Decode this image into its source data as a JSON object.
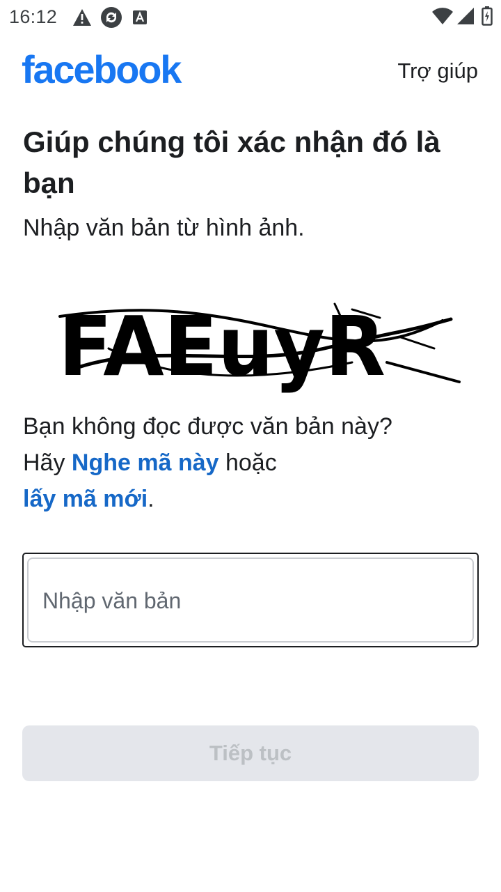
{
  "status_bar": {
    "time": "16:12",
    "left_icons": [
      "warning-icon",
      "sync-icon",
      "font-icon"
    ],
    "right_icons": [
      "wifi-icon",
      "signal-icon",
      "battery-icon"
    ]
  },
  "header": {
    "logo": "facebook",
    "help": "Trợ giúp"
  },
  "content": {
    "title": "Giúp chúng tôi xác nhận đó là bạn",
    "subtitle": "Nhập văn bản từ hình ảnh.",
    "captcha_text": "FAEuyR",
    "help_prefix": "Bạn không đọc được văn bản này? Hãy ",
    "listen_link": "Nghe mã này",
    "help_middle": " hoặc ",
    "new_code_link": "lấy mã mới",
    "help_suffix": ".",
    "input_placeholder": "Nhập văn bản",
    "input_value": "",
    "continue_label": "Tiếp tục"
  },
  "colors": {
    "brand": "#1877f2",
    "link": "#1668c7",
    "disabled_bg": "#e4e6eb",
    "disabled_text": "#bcc0c4"
  }
}
